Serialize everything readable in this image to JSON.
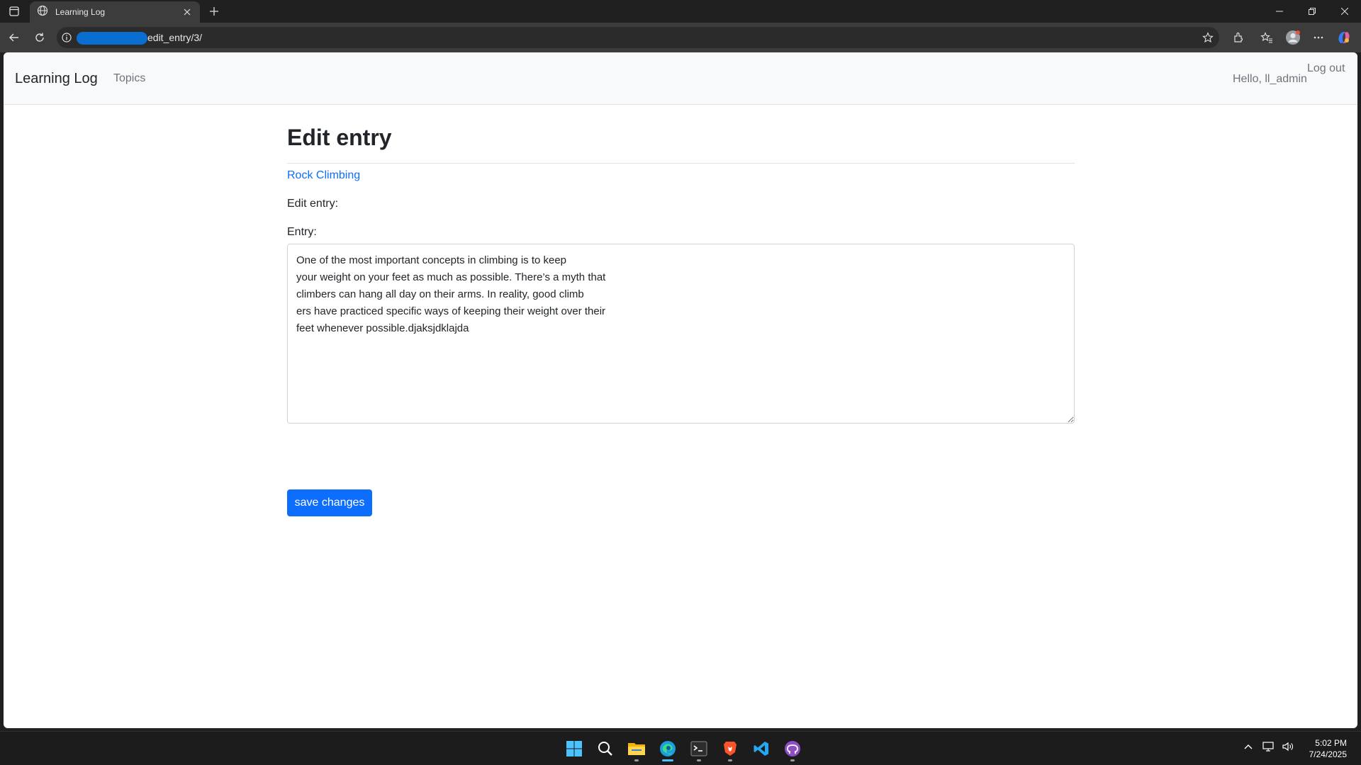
{
  "browser": {
    "tab_title": "Learning Log",
    "url": "edit_entry/3/"
  },
  "navbar": {
    "brand": "Learning Log",
    "topics": "Topics",
    "hello": "Hello, ll_admin",
    "logout": "Log out"
  },
  "main": {
    "title": "Edit entry",
    "topic_link": "Rock Climbing",
    "form_heading": "Edit entry:",
    "entry_label": "Entry:",
    "entry_text": "One of the most important concepts in climbing is to keep\nyour weight on your feet as much as possible. There’s a myth that\nclimbers can hang all day on their arms. In reality, good climb\ners have practiced specific ways of keeping their weight over their\nfeet whenever possible.djaksjdklajda",
    "save_button": "save changes"
  },
  "taskbar": {
    "apps": [
      "start-icon",
      "search-icon",
      "file-explorer-icon",
      "edge-icon",
      "terminal-icon",
      "brave-icon",
      "vscode-icon",
      "github-desktop-icon"
    ],
    "time": "5:02 PM",
    "date": "7/24/2025"
  },
  "colors": {
    "link": "#0d6efd",
    "button": "#0d6efd",
    "navbar_bg": "#f8f9fa",
    "muted": "#6c757d"
  }
}
